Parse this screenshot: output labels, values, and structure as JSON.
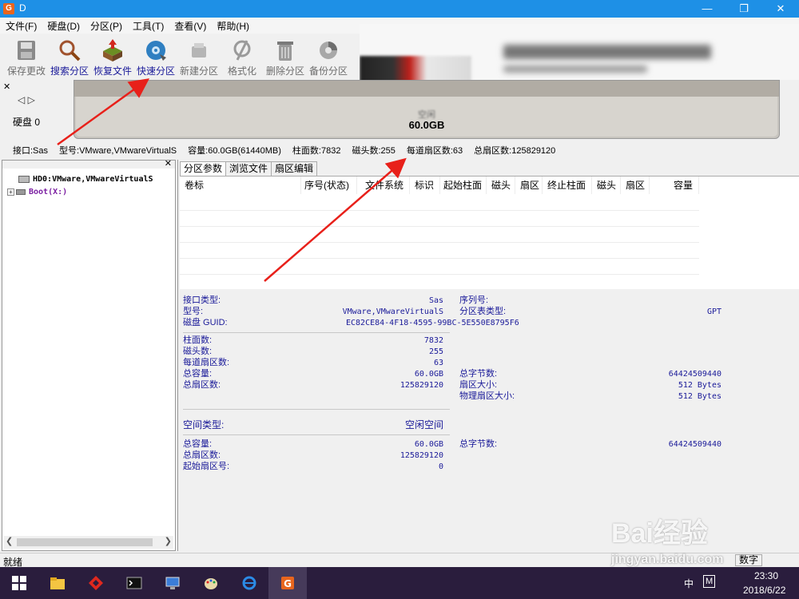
{
  "window": {
    "title": "D",
    "icon": "disk-genius-app-icon"
  },
  "menu": [
    "文件(F)",
    "硬盘(D)",
    "分区(P)",
    "工具(T)",
    "查看(V)",
    "帮助(H)"
  ],
  "toolbar": [
    {
      "label": "保存更改",
      "icon": "save-disk-icon",
      "enabled": false
    },
    {
      "label": "搜索分区",
      "icon": "magnifier-icon",
      "enabled": true
    },
    {
      "label": "恢复文件",
      "icon": "restore-box-icon",
      "enabled": true
    },
    {
      "label": "快速分区",
      "icon": "quick-partition-disc-icon",
      "enabled": true
    },
    {
      "label": "新建分区",
      "icon": "new-partition-icon",
      "enabled": false
    },
    {
      "label": "格式化",
      "icon": "format-icon",
      "enabled": false
    },
    {
      "label": "删除分区",
      "icon": "trash-icon",
      "enabled": false
    },
    {
      "label": "备份分区",
      "icon": "backup-icon",
      "enabled": false
    }
  ],
  "disk": {
    "label": "硬盘 0",
    "capacity": "60.0GB",
    "bar_sub": "空闲",
    "info": [
      "接口:Sas",
      "型号:VMware,VMwareVirtualS",
      "容量:60.0GB(61440MB)",
      "柱面数:7832",
      "磁头数:255",
      "每道扇区数:63",
      "总扇区数:125829120"
    ]
  },
  "tree": {
    "disk": "HD0:VMware,VMwareVirtualS",
    "partition": "Boot(X:)"
  },
  "tabs": [
    "分区参数",
    "浏览文件",
    "扇区编辑"
  ],
  "table_headers": [
    "卷标",
    "序号(状态)",
    "文件系统",
    "标识",
    "起始柱面",
    "磁头",
    "扇区",
    "终止柱面",
    "磁头",
    "扇区",
    "容量"
  ],
  "details": {
    "interface_label": "接口类型:",
    "interface_value": "Sas",
    "serial_label": "序列号:",
    "model_label": "型号:",
    "model_value": "VMware,VMwareVirtualS",
    "pt_type_label": "分区表类型:",
    "pt_type_value": "GPT",
    "guid_label": "磁盘 GUID:",
    "guid_value": "EC82CE84-4F18-4595-99BC-5E550E8795F6",
    "cyl_label": "柱面数:",
    "cyl_value": "7832",
    "heads_label": "磁头数:",
    "heads_value": "255",
    "spt_label": "每道扇区数:",
    "spt_value": "63",
    "total_cap_label": "总容量:",
    "total_cap_value": "60.0GB",
    "total_bytes_label": "总字节数:",
    "total_bytes_value": "64424509440",
    "total_sec_label": "总扇区数:",
    "total_sec_value": "125829120",
    "sec_size_label": "扇区大小:",
    "sec_size_value": "512 Bytes",
    "phys_sec_label": "物理扇区大小:",
    "phys_sec_value": "512 Bytes",
    "space_type_label": "空间类型:",
    "space_type_value": "空闲空间",
    "free_cap_label": "总容量:",
    "free_cap_value": "60.0GB",
    "free_bytes_label": "总字节数:",
    "free_bytes_value": "64424509440",
    "free_sec_label": "总扇区数:",
    "free_sec_value": "125829120",
    "start_sec_label": "起始扇区号:",
    "start_sec_value": "0"
  },
  "status": {
    "text": "就绪",
    "numlock": "数字"
  },
  "taskbar": {
    "time": "23:30",
    "date": "2018/6/22",
    "ime": "中",
    "ime2": "M"
  },
  "watermark": {
    "brand": "Bai经验",
    "url": "jingyan.baidu.com"
  },
  "colors": {
    "titlebar": "#1e90e6",
    "annotation_arrow": "#e8201a",
    "label_blue": "#1a1a99",
    "taskbar": "#2a1d3d"
  }
}
